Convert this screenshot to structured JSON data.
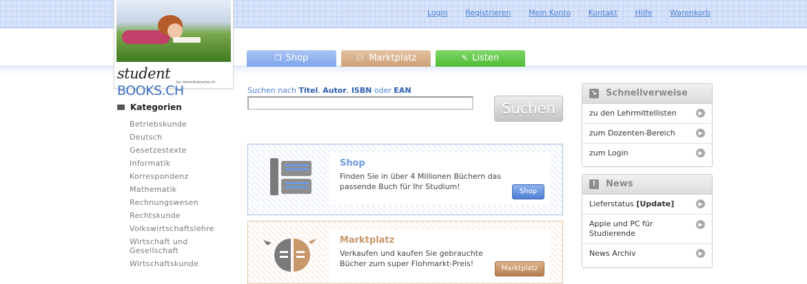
{
  "topnav": {
    "login": "Login",
    "register": "Registrieren",
    "account": "Mein Konto",
    "contact": "Kontakt",
    "help": "Hilfe",
    "cart": "Warenkorb"
  },
  "logo": {
    "student": "student",
    "books": "BOOKS.CH",
    "sub": "by: lehrmittelcenter.ch"
  },
  "tabs": {
    "shop": "Shop",
    "markt": "Marktplatz",
    "listen": "Listen"
  },
  "categories": {
    "heading": "Kategorien",
    "items": [
      "Betriebskunde",
      "Deutsch",
      "Gesetzestexte",
      "Informatik",
      "Korrespondenz",
      "Mathematik",
      "Rechnungswesen",
      "Rechtskunde",
      "Volkswirtschaftslehre",
      "Wirtschaft und Gesellschaft",
      "Wirtschaftskunde"
    ]
  },
  "search": {
    "prefix": "Suchen nach ",
    "titel": "Titel",
    "sep1": ", ",
    "autor": "Autor",
    "sep2": ", ",
    "isbn": "ISBN",
    "oder": " oder ",
    "ean": "EAN",
    "input_value": "",
    "button": "Suchen"
  },
  "promo_shop": {
    "title": "Shop",
    "text": "Finden Sie in über 4 Millionen Büchern das passende Buch für Ihr Studium!",
    "button": "Shop"
  },
  "promo_markt": {
    "title": "Marktplatz",
    "text": "Verkaufen und kaufen Sie gebrauchte Bücher zum super Flohmarkt-Preis!",
    "button": "Marktplatz"
  },
  "quicklinks": {
    "heading": "Schnellverweise",
    "items": [
      "zu den Lehrmittellisten",
      "zum Dozenten-Bereich",
      "zum Login"
    ]
  },
  "news": {
    "heading": "News",
    "item1_text": "Lieferstatus ",
    "item1_bold": "[Update]",
    "item2": "Apple und PC für Studierende",
    "item3": "News Archiv"
  },
  "colors": {
    "accent_blue": "#4a7fd0",
    "shop_blue": "#7ea5ea",
    "markt_brown": "#cc9f76",
    "listen_green": "#4fba34"
  }
}
